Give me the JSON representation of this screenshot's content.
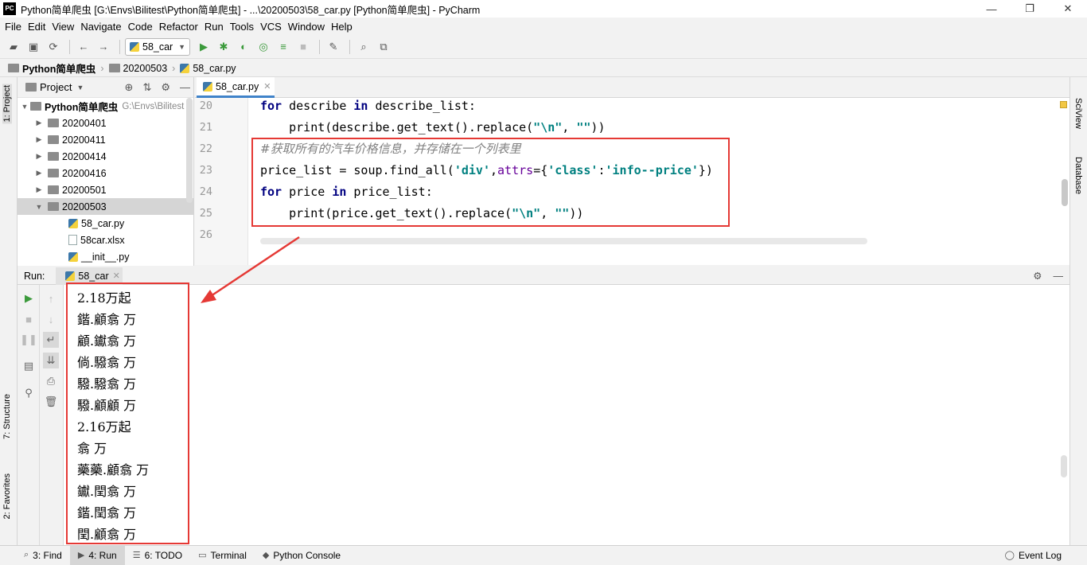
{
  "window": {
    "app_badge": "PC",
    "title": "Python简单爬虫 [G:\\Envs\\Bilitest\\Python简单爬虫] - ...\\20200503\\58_car.py [Python简单爬虫] - PyCharm",
    "minimize": "—",
    "maximize": "❐",
    "close": "✕"
  },
  "menu": [
    "File",
    "Edit",
    "View",
    "Navigate",
    "Code",
    "Refactor",
    "Run",
    "Tools",
    "VCS",
    "Window",
    "Help"
  ],
  "toolbar": {
    "run_config": "58_car"
  },
  "breadcrumb": [
    "Python简单爬虫",
    "20200503",
    "58_car.py"
  ],
  "project_panel": {
    "title": "Project",
    "root_name": "Python简单爬虫",
    "root_path": "G:\\Envs\\Bilitest",
    "folders": [
      "20200401",
      "20200411",
      "20200414",
      "20200416",
      "20200501",
      "20200503"
    ],
    "files": [
      "58_car.py",
      "58car.xlsx",
      "__init__.py"
    ]
  },
  "editor": {
    "tab": "58_car.py",
    "line_numbers": [
      "20",
      "21",
      "22",
      "23",
      "24",
      "25",
      "26"
    ],
    "lines": {
      "l20_kw1": "for",
      "l20_a": " describe ",
      "l20_kw2": "in",
      "l20_b": " describe_list:",
      "l21_a": "    print(describe.get_text().replace(",
      "l21_s1": "\"\\n\"",
      "l21_b": ", ",
      "l21_s2": "\"\"",
      "l21_c": "))",
      "l22_comment": "#获取所有的汽车价格信息，并存储在一个列表里",
      "l23_a": "price_list = soup.find_all(",
      "l23_s1": "'div'",
      "l23_b": ",",
      "l23_p": "attrs",
      "l23_c": "={",
      "l23_s2": "'class'",
      "l23_d": ":",
      "l23_s3": "'info--price'",
      "l23_e": "})",
      "l24_kw1": "for",
      "l24_a": " price ",
      "l24_kw2": "in",
      "l24_b": " price_list:",
      "l25_a": "    print(price.get_text().replace(",
      "l25_s1": "\"\\n\"",
      "l25_b": ", ",
      "l25_s2": "\"\"",
      "l25_c": "))"
    }
  },
  "run_panel": {
    "label": "Run:",
    "tab": "58_car",
    "output": [
      "2.18万起",
      "鍇.顧翕 万",
      "顧.钀翕 万",
      "倘.驋翕 万",
      "驋.驋翕 万",
      "驋.顧顧 万",
      "2.16万起",
      "翕 万",
      "藥藥.顧翕 万",
      "钀.閏翕 万",
      "鍇.閏翕 万",
      "閏.顧翕 万"
    ]
  },
  "side_tabs": {
    "left": [
      "1: Project",
      "7: Structure",
      "2: Favorites"
    ],
    "right": [
      "SciView",
      "Database"
    ]
  },
  "status_bar": {
    "items": [
      "3: Find",
      "4: Run",
      "6: TODO",
      "Terminal",
      "Python Console"
    ],
    "right": "Event Log"
  },
  "colors": {
    "annotation_red": "#e53935",
    "keyword": "#000080",
    "string": "#008080",
    "comment": "#808080",
    "param": "#660099"
  }
}
